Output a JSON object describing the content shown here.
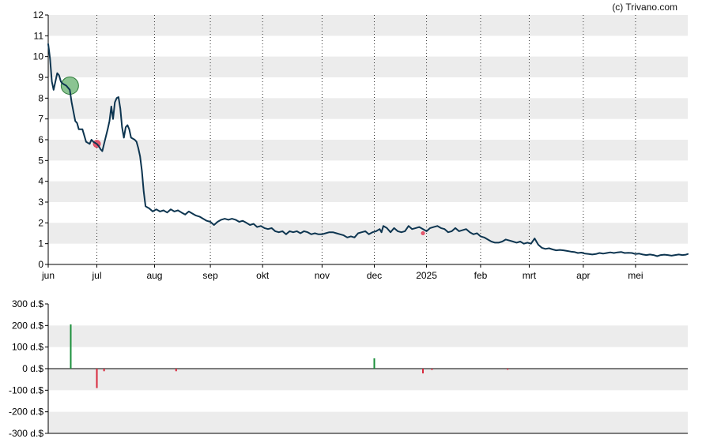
{
  "credit": "(c) Trivano.com",
  "colors": {
    "line": "#0d3550",
    "band": "#ececec",
    "buy": "#1a8f3a",
    "sell": "#d8283c",
    "buy_marker": "#3d9c4a",
    "sell_marker": "#e0435b"
  },
  "chart_data": [
    {
      "type": "line",
      "x_domain": [
        0,
        355
      ],
      "ylim": [
        0,
        12
      ],
      "yticks": [
        "0",
        "1",
        "2",
        "3",
        "4",
        "5",
        "6",
        "7",
        "8",
        "9",
        "10",
        "11",
        "12"
      ],
      "xticks": [
        {
          "label": "jun",
          "x": 0
        },
        {
          "label": "jul",
          "x": 27
        },
        {
          "label": "aug",
          "x": 59
        },
        {
          "label": "sep",
          "x": 90
        },
        {
          "label": "okt",
          "x": 119
        },
        {
          "label": "nov",
          "x": 152
        },
        {
          "label": "dec",
          "x": 181
        },
        {
          "label": "2025",
          "x": 210
        },
        {
          "label": "feb",
          "x": 240
        },
        {
          "label": "mrt",
          "x": 267
        },
        {
          "label": "apr",
          "x": 297
        },
        {
          "label": "mei",
          "x": 326
        }
      ],
      "grid": "alternating horizontal bands, dotted vertical lines at month ticks",
      "series": [
        {
          "points": [
            [
              0,
              10.6
            ],
            [
              1,
              9.9
            ],
            [
              2,
              8.8
            ],
            [
              3,
              8.4
            ],
            [
              4,
              8.8
            ],
            [
              5,
              9.2
            ],
            [
              6,
              9.1
            ],
            [
              7,
              8.8
            ],
            [
              8,
              8.7
            ],
            [
              10,
              8.6
            ],
            [
              12,
              8.4
            ],
            [
              13,
              7.8
            ],
            [
              15,
              6.9
            ],
            [
              16,
              6.8
            ],
            [
              17,
              6.5
            ],
            [
              19,
              6.5
            ],
            [
              20,
              6.2
            ],
            [
              21,
              5.9
            ],
            [
              23,
              5.8
            ],
            [
              24,
              6.0
            ],
            [
              25,
              5.9
            ],
            [
              26,
              5.85
            ],
            [
              27,
              5.8
            ],
            [
              28,
              5.7
            ],
            [
              29,
              5.55
            ],
            [
              30,
              5.45
            ],
            [
              31,
              5.8
            ],
            [
              33,
              6.5
            ],
            [
              34,
              6.9
            ],
            [
              35,
              7.6
            ],
            [
              36,
              7.0
            ],
            [
              37,
              7.8
            ],
            [
              38,
              8.0
            ],
            [
              39,
              8.05
            ],
            [
              40,
              7.5
            ],
            [
              41,
              6.6
            ],
            [
              42,
              6.1
            ],
            [
              43,
              6.6
            ],
            [
              44,
              6.7
            ],
            [
              45,
              6.5
            ],
            [
              46,
              6.1
            ],
            [
              48,
              6.0
            ],
            [
              49,
              5.9
            ],
            [
              50,
              5.6
            ],
            [
              51,
              5.2
            ],
            [
              52,
              4.5
            ],
            [
              53,
              3.5
            ],
            [
              54,
              2.8
            ],
            [
              55,
              2.75
            ],
            [
              56,
              2.7
            ],
            [
              58,
              2.55
            ],
            [
              60,
              2.65
            ],
            [
              62,
              2.55
            ],
            [
              64,
              2.6
            ],
            [
              66,
              2.5
            ],
            [
              68,
              2.65
            ],
            [
              70,
              2.55
            ],
            [
              72,
              2.6
            ],
            [
              74,
              2.5
            ],
            [
              76,
              2.4
            ],
            [
              78,
              2.55
            ],
            [
              80,
              2.45
            ],
            [
              82,
              2.35
            ],
            [
              84,
              2.3
            ],
            [
              86,
              2.2
            ],
            [
              88,
              2.1
            ],
            [
              90,
              2.05
            ],
            [
              92,
              1.9
            ],
            [
              94,
              2.05
            ],
            [
              96,
              2.15
            ],
            [
              98,
              2.2
            ],
            [
              100,
              2.15
            ],
            [
              102,
              2.2
            ],
            [
              104,
              2.15
            ],
            [
              106,
              2.05
            ],
            [
              108,
              2.1
            ],
            [
              110,
              2.0
            ],
            [
              112,
              1.9
            ],
            [
              114,
              1.95
            ],
            [
              116,
              1.8
            ],
            [
              118,
              1.85
            ],
            [
              120,
              1.75
            ],
            [
              122,
              1.7
            ],
            [
              124,
              1.75
            ],
            [
              126,
              1.6
            ],
            [
              128,
              1.55
            ],
            [
              130,
              1.6
            ],
            [
              132,
              1.45
            ],
            [
              134,
              1.6
            ],
            [
              136,
              1.55
            ],
            [
              138,
              1.6
            ],
            [
              140,
              1.5
            ],
            [
              142,
              1.6
            ],
            [
              144,
              1.55
            ],
            [
              146,
              1.45
            ],
            [
              148,
              1.5
            ],
            [
              150,
              1.45
            ],
            [
              152,
              1.45
            ],
            [
              154,
              1.5
            ],
            [
              156,
              1.55
            ],
            [
              158,
              1.55
            ],
            [
              160,
              1.5
            ],
            [
              162,
              1.45
            ],
            [
              164,
              1.4
            ],
            [
              166,
              1.3
            ],
            [
              168,
              1.35
            ],
            [
              170,
              1.3
            ],
            [
              172,
              1.5
            ],
            [
              174,
              1.55
            ],
            [
              176,
              1.6
            ],
            [
              178,
              1.45
            ],
            [
              180,
              1.55
            ],
            [
              182,
              1.6
            ],
            [
              184,
              1.7
            ],
            [
              185,
              1.55
            ],
            [
              186,
              1.85
            ],
            [
              188,
              1.75
            ],
            [
              190,
              1.55
            ],
            [
              192,
              1.75
            ],
            [
              194,
              1.6
            ],
            [
              196,
              1.55
            ],
            [
              198,
              1.6
            ],
            [
              200,
              1.85
            ],
            [
              202,
              1.7
            ],
            [
              204,
              1.75
            ],
            [
              206,
              1.8
            ],
            [
              208,
              1.7
            ],
            [
              210,
              1.6
            ],
            [
              212,
              1.75
            ],
            [
              214,
              1.8
            ],
            [
              216,
              1.85
            ],
            [
              218,
              1.75
            ],
            [
              220,
              1.7
            ],
            [
              222,
              1.55
            ],
            [
              224,
              1.6
            ],
            [
              226,
              1.75
            ],
            [
              228,
              1.6
            ],
            [
              230,
              1.65
            ],
            [
              232,
              1.7
            ],
            [
              234,
              1.55
            ],
            [
              236,
              1.45
            ],
            [
              238,
              1.5
            ],
            [
              240,
              1.35
            ],
            [
              242,
              1.3
            ],
            [
              244,
              1.2
            ],
            [
              246,
              1.1
            ],
            [
              248,
              1.05
            ],
            [
              250,
              1.05
            ],
            [
              252,
              1.1
            ],
            [
              254,
              1.2
            ],
            [
              256,
              1.15
            ],
            [
              258,
              1.1
            ],
            [
              260,
              1.05
            ],
            [
              262,
              1.1
            ],
            [
              264,
              1.0
            ],
            [
              266,
              1.05
            ],
            [
              268,
              1.0
            ],
            [
              270,
              1.25
            ],
            [
              272,
              0.95
            ],
            [
              274,
              0.8
            ],
            [
              276,
              0.75
            ],
            [
              278,
              0.78
            ],
            [
              280,
              0.72
            ],
            [
              282,
              0.68
            ],
            [
              284,
              0.7
            ],
            [
              286,
              0.68
            ],
            [
              288,
              0.65
            ],
            [
              290,
              0.62
            ],
            [
              292,
              0.6
            ],
            [
              294,
              0.55
            ],
            [
              296,
              0.57
            ],
            [
              298,
              0.52
            ],
            [
              300,
              0.5
            ],
            [
              302,
              0.48
            ],
            [
              304,
              0.5
            ],
            [
              306,
              0.55
            ],
            [
              308,
              0.52
            ],
            [
              310,
              0.55
            ],
            [
              312,
              0.58
            ],
            [
              314,
              0.55
            ],
            [
              316,
              0.58
            ],
            [
              318,
              0.6
            ],
            [
              320,
              0.55
            ],
            [
              322,
              0.56
            ],
            [
              324,
              0.55
            ],
            [
              326,
              0.5
            ],
            [
              328,
              0.52
            ],
            [
              330,
              0.48
            ],
            [
              332,
              0.45
            ],
            [
              334,
              0.48
            ],
            [
              336,
              0.45
            ],
            [
              338,
              0.4
            ],
            [
              340,
              0.45
            ],
            [
              342,
              0.47
            ],
            [
              344,
              0.45
            ],
            [
              346,
              0.42
            ],
            [
              348,
              0.45
            ],
            [
              350,
              0.48
            ],
            [
              352,
              0.45
            ],
            [
              354,
              0.47
            ],
            [
              355,
              0.5
            ]
          ]
        }
      ],
      "markers": [
        {
          "kind": "buy",
          "x": 12,
          "y": 8.6,
          "size": "large"
        },
        {
          "kind": "sell",
          "x": 27,
          "y": 5.8,
          "size": "small"
        },
        {
          "kind": "sell",
          "x": 208,
          "y": 1.5,
          "size": "tiny"
        }
      ]
    },
    {
      "type": "bar",
      "x_domain": [
        0,
        355
      ],
      "ylim": [
        -300,
        300
      ],
      "yticks": [
        "300 d.$",
        "200 d.$",
        "100 d.$",
        "0 d.$",
        "-100 d.$",
        "-200 d.$",
        "-300 d.$"
      ],
      "grid": "alternating horizontal bands",
      "bars": [
        {
          "x": 12.5,
          "value": 205
        },
        {
          "x": 27,
          "value": -90
        },
        {
          "x": 31,
          "value": -12
        },
        {
          "x": 71,
          "value": -12
        },
        {
          "x": 181,
          "value": 48
        },
        {
          "x": 208,
          "value": -22
        },
        {
          "x": 213,
          "value": -6
        },
        {
          "x": 255,
          "value": -5
        }
      ]
    }
  ]
}
